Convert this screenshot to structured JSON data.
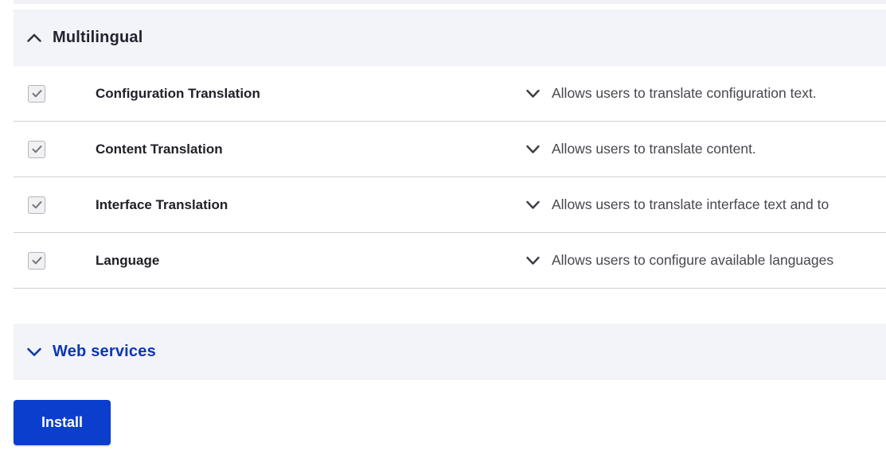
{
  "theme": {
    "band_background": "#f3f4f9",
    "divider": "#cfcfd6",
    "header_text": "#222330",
    "link_blue": "#0c36b5",
    "button_blue": "#0b3ecc",
    "module_name_text": "#202128",
    "description_text": "#47484d"
  },
  "sections": {
    "multilingual": {
      "label": "Multilingual",
      "state": "expanded"
    },
    "web_services": {
      "label": "Web services",
      "state": "collapsed"
    }
  },
  "modules": [
    {
      "name": "Configuration Translation",
      "checked": true,
      "description": "Allows users to translate configuration text."
    },
    {
      "name": "Content Translation",
      "checked": true,
      "description": "Allows users to translate content."
    },
    {
      "name": "Interface Translation",
      "checked": true,
      "description": "Allows users to translate interface text and to"
    },
    {
      "name": "Language",
      "checked": true,
      "description": "Allows users to configure available languages"
    }
  ],
  "actions": {
    "install_label": "Install"
  }
}
